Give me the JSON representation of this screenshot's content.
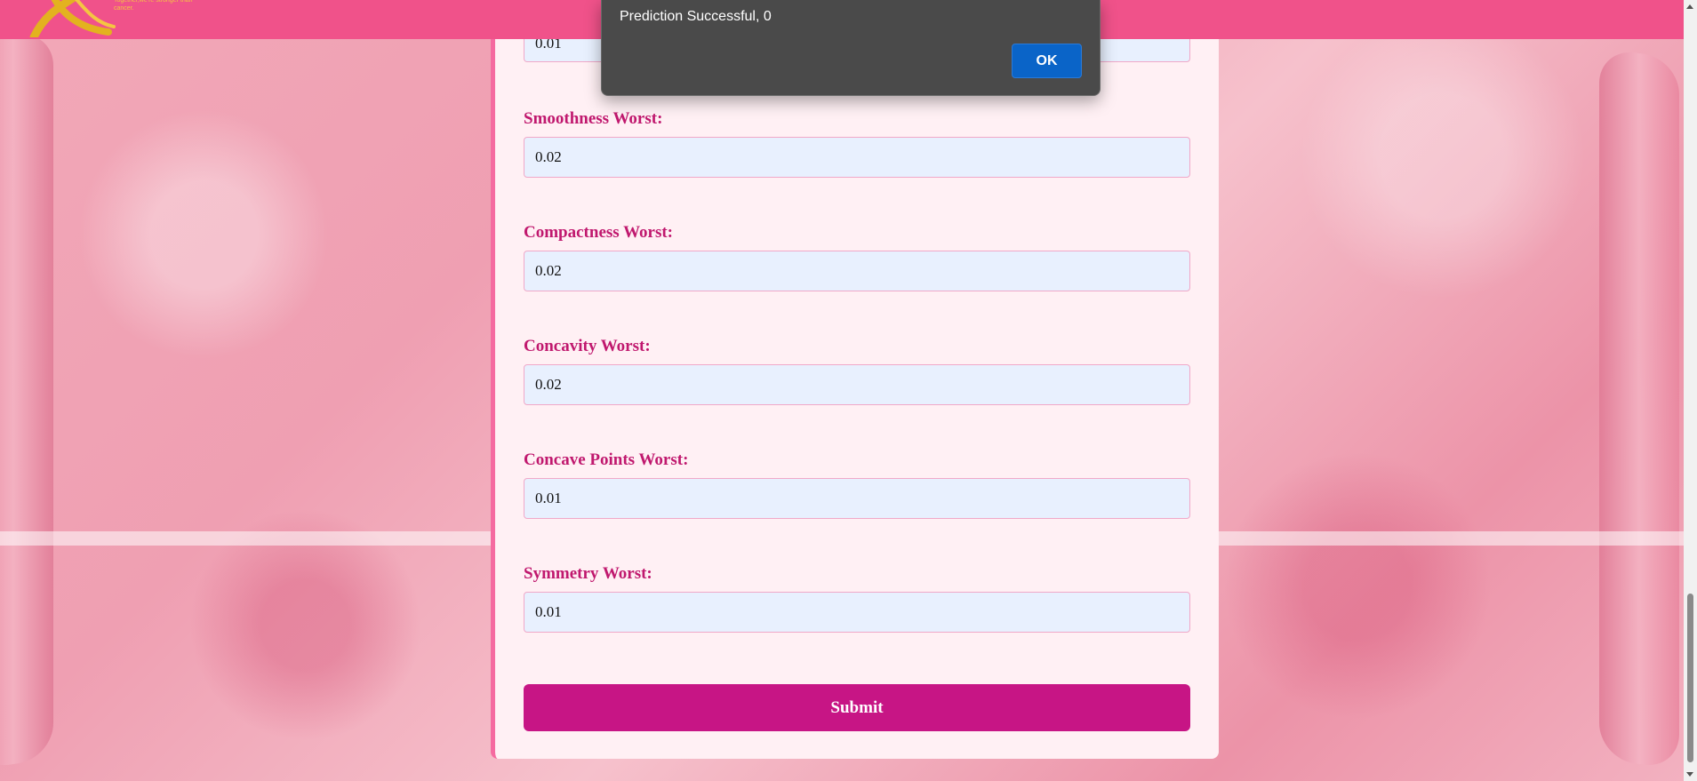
{
  "header": {
    "logo_tagline": "Together,we're stronger than cancer."
  },
  "form": {
    "partial_value": "0.01",
    "fields": [
      {
        "label": "Smoothness Worst:",
        "value": "0.02"
      },
      {
        "label": "Compactness Worst:",
        "value": "0.02"
      },
      {
        "label": "Concavity Worst:",
        "value": "0.02"
      },
      {
        "label": "Concave Points Worst:",
        "value": "0.01"
      },
      {
        "label": "Symmetry Worst:",
        "value": "0.01"
      }
    ],
    "submit_label": "Submit"
  },
  "dialog": {
    "message": "Prediction Successful, 0",
    "ok_label": "OK"
  },
  "colors": {
    "header": "#f0528a",
    "label": "#c0186e",
    "submit": "#c71585",
    "input_bg": "#e8f0fe",
    "dialog_bg": "#4a4a4a",
    "ok_button": "#0a64c8"
  }
}
